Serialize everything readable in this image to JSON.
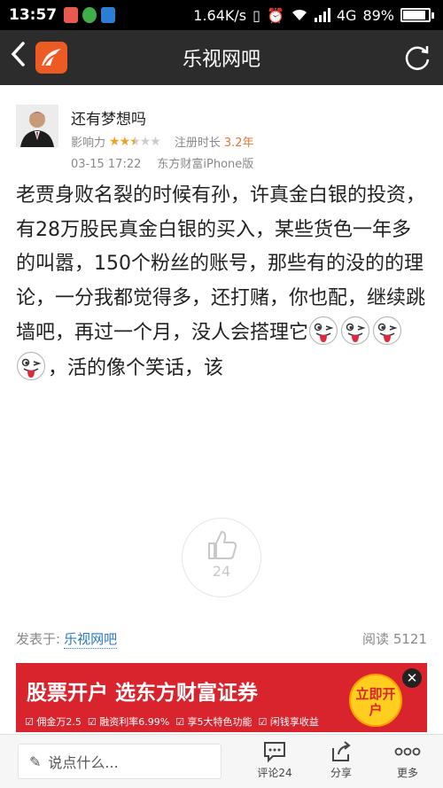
{
  "status_bar": {
    "time": "13:57",
    "speed": "1.64K/s",
    "network": "4G",
    "battery": "89%",
    "battery_level": 0.89
  },
  "nav": {
    "title": "乐视网吧",
    "back_icon": "chevron-left-icon",
    "refresh_icon": "refresh-icon"
  },
  "post": {
    "username": "还有梦想吗",
    "influence_label": "影响力",
    "influence_stars": 2.5,
    "register_label": "注册时长",
    "register_value": "3.2年",
    "time": "03-15 17:22",
    "source": "东方财富iPhone版",
    "body_text": "老贾身败名裂的时候有孙，许真金白银的投资，有28万股民真金白银的买入，某些货色一年多的叫嚣，150个粉丝的账号，那些有的没的的理论，一分我都觉得多，还打赌，你也配，继续跳墙吧，再过一个月，没人会搭理它",
    "body_tail": "，活的像个笑话，该",
    "emoji_count": 4,
    "likes": "24"
  },
  "meta": {
    "posted_in_label": "发表于:",
    "bar_name": "乐视网吧",
    "reads_label": "阅读",
    "reads_value": "5121"
  },
  "ad": {
    "title": "股票开户  选东方财富证券",
    "features": [
      "佣金万2.5",
      "融资利率6.99%",
      "享5大特色功能",
      "闲钱享收益"
    ],
    "cta": "立即开户"
  },
  "bottom": {
    "comment_placeholder": "说点什么...",
    "comment_label": "评论24",
    "share_label": "分享",
    "more_label": "更多"
  },
  "colors": {
    "nav_bg": "#2c2c2c",
    "accent_orange": "#ee5a24",
    "link_blue": "#2a78c2",
    "ad_red": "#d9232d"
  }
}
